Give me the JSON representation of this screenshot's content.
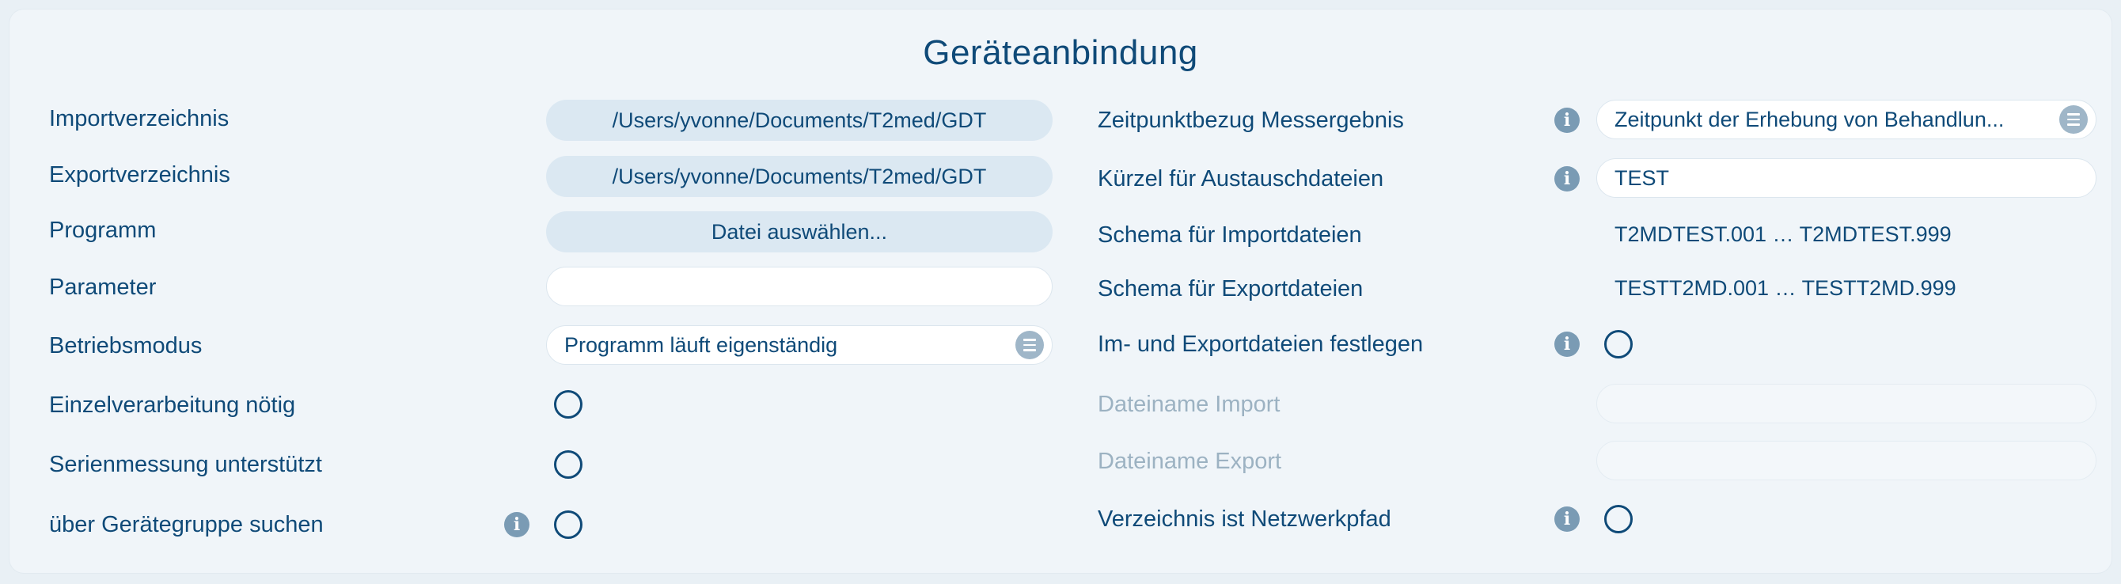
{
  "title": "Geräteanbindung",
  "left": {
    "import_dir": {
      "label": "Importverzeichnis",
      "value": "/Users/yvonne/Documents/T2med/GDT"
    },
    "export_dir": {
      "label": "Exportverzeichnis",
      "value": "/Users/yvonne/Documents/T2med/GDT"
    },
    "program": {
      "label": "Programm",
      "value": "Datei auswählen..."
    },
    "parameter": {
      "label": "Parameter",
      "value": ""
    },
    "mode": {
      "label": "Betriebsmodus",
      "value": "Programm läuft eigenständig"
    },
    "single_processing": {
      "label": "Einzelverarbeitung nötig",
      "checked": false
    },
    "series_measurement": {
      "label": "Serienmessung unterstützt",
      "checked": false
    },
    "search_group": {
      "label": "über Gerätegruppe suchen",
      "checked": false
    }
  },
  "right": {
    "time_reference": {
      "label": "Zeitpunktbezug Messergebnis",
      "value": "Zeitpunkt der Erhebung von Behandlun..."
    },
    "abbreviation": {
      "label": "Kürzel für Austauschdateien",
      "value": "TEST"
    },
    "import_schema": {
      "label": "Schema für Importdateien",
      "value": "T2MDTEST.001 … T2MDTEST.999"
    },
    "export_schema": {
      "label": "Schema für Exportdateien",
      "value": "TESTT2MD.001 … TESTT2MD.999"
    },
    "define_files": {
      "label": "Im- und Exportdateien festlegen",
      "checked": false
    },
    "import_filename": {
      "label": "Dateiname Import",
      "value": ""
    },
    "export_filename": {
      "label": "Dateiname Export",
      "value": ""
    },
    "network_path": {
      "label": "Verzeichnis ist Netzwerkpfad",
      "checked": false
    }
  },
  "icons": {
    "info": "info-icon",
    "select": "list-select-icon"
  },
  "colors": {
    "text": "#0f4a78",
    "disabled_text": "#9cb2c2",
    "button_bg": "#dbe8f2",
    "info_bg": "#7a9bb4"
  }
}
